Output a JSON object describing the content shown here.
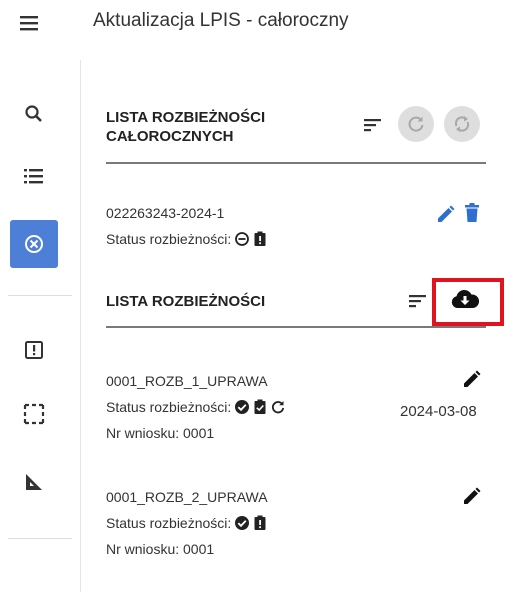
{
  "app": {
    "title": "Aktualizacja LPIS - całoroczny"
  },
  "rail": {
    "items": [
      {
        "icon": "search-icon"
      },
      {
        "icon": "list-icon"
      },
      {
        "icon": "cancel-circle-icon",
        "active": true
      },
      {
        "icon": "alert-box-icon"
      },
      {
        "icon": "select-dashed-icon"
      },
      {
        "icon": "ruler-triangle-icon"
      }
    ]
  },
  "annual": {
    "title_line1": "LISTA ROZBIEŻNOŚCI",
    "title_line2": "CAŁOROCZNYCH",
    "item": {
      "id": "022263243-2024-1",
      "status_label": "Status rozbieżności:"
    }
  },
  "discrepancies": {
    "title": "LISTA ROZBIEŻNOŚCI",
    "items": [
      {
        "name": "0001_ROZB_1_UPRAWA",
        "status_label": "Status rozbieżności:",
        "date": "2024-03-08",
        "request": "Nr wniosku: 0001"
      },
      {
        "name": "0001_ROZB_2_UPRAWA",
        "status_label": "Status rozbieżności:",
        "date": "",
        "request": "Nr wniosku: 0001"
      }
    ]
  },
  "colors": {
    "accent": "#4d7fd6",
    "edit_blue": "#2f6fd0",
    "highlight": "#e0141f"
  }
}
